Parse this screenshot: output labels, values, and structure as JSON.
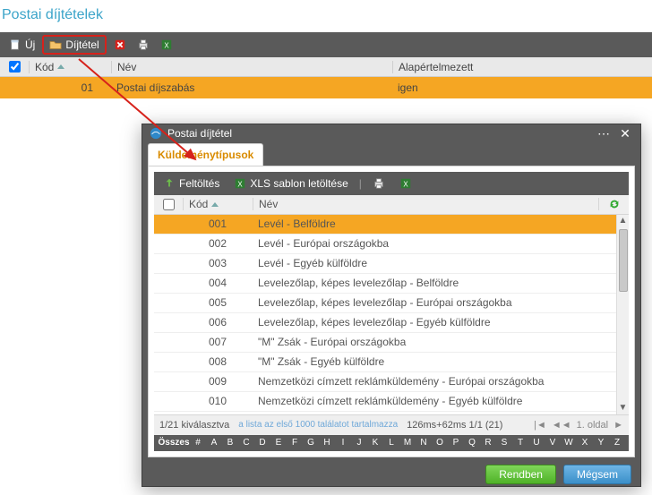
{
  "page": {
    "title": "Postai díjtételek"
  },
  "toolbar": {
    "new_label": "Új",
    "tariff_label": "Díjtétel"
  },
  "main_grid": {
    "cols": {
      "kod": "Kód",
      "nev": "Név",
      "alap": "Alapértelmezett"
    },
    "row": {
      "kod": "01",
      "nev": "Postai díjszabás",
      "alap": "igen"
    }
  },
  "modal": {
    "title": "Postai díjtétel",
    "tab": "Küldeménytípusok",
    "toolbar": {
      "upload": "Feltöltés",
      "xls": "XLS sablon letöltése"
    },
    "grid": {
      "cols": {
        "kod": "Kód",
        "nev": "Név"
      },
      "rows": [
        {
          "kod": "001",
          "nev": "Levél - Belföldre"
        },
        {
          "kod": "002",
          "nev": "Levél - Európai országokba"
        },
        {
          "kod": "003",
          "nev": "Levél - Egyéb külföldre"
        },
        {
          "kod": "004",
          "nev": "Levelezőlap, képes levelezőlap - Belföldre"
        },
        {
          "kod": "005",
          "nev": "Levelezőlap, képes levelezőlap - Európai országokba"
        },
        {
          "kod": "006",
          "nev": "Levelezőlap, képes levelezőlap - Egyéb külföldre"
        },
        {
          "kod": "007",
          "nev": "\"M\" Zsák - Európai országokba"
        },
        {
          "kod": "008",
          "nev": "\"M\" Zsák - Egyéb külföldre"
        },
        {
          "kod": "009",
          "nev": "Nemzetközi címzett reklámküldemény - Európai országokba"
        },
        {
          "kod": "010",
          "nev": "Nemzetközi címzett reklámküldemény - Egyéb külföldre"
        }
      ],
      "footer_sel": "1/21 kiválasztva",
      "footer_hint": "a lista az első 1000 találatot tartalmazza",
      "footer_timing": "126ms+62ms 1/1 (21)",
      "page_label": "1. oldal",
      "alpha_all": "Összes",
      "alpha": [
        "#",
        "A",
        "B",
        "C",
        "D",
        "E",
        "F",
        "G",
        "H",
        "I",
        "J",
        "K",
        "L",
        "M",
        "N",
        "O",
        "P",
        "Q",
        "R",
        "S",
        "T",
        "U",
        "V",
        "W",
        "X",
        "Y",
        "Z"
      ]
    },
    "buttons": {
      "ok": "Rendben",
      "cancel": "Mégsem"
    }
  }
}
